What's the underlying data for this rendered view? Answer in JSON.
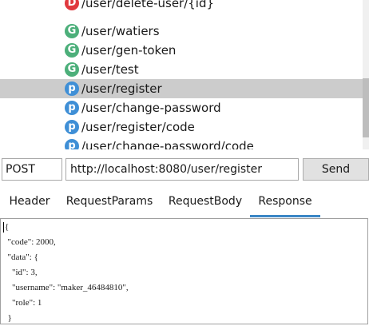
{
  "endpoints": [
    {
      "badge": "D",
      "method": "delete",
      "path": "/user/delete-user/{id}"
    },
    {
      "badge": "G",
      "method": "get",
      "path": "/user/watiers"
    },
    {
      "badge": "G",
      "method": "get",
      "path": "/user/gen-token"
    },
    {
      "badge": "G",
      "method": "get",
      "path": "/user/test"
    },
    {
      "badge": "p",
      "method": "post",
      "path": "/user/register",
      "selected": true
    },
    {
      "badge": "p",
      "method": "post",
      "path": "/user/change-password"
    },
    {
      "badge": "p",
      "method": "post",
      "path": "/user/register/code"
    },
    {
      "badge": "p",
      "method": "post",
      "path": "/user/change-password/code"
    }
  ],
  "request": {
    "method": "POST",
    "url": "http://localhost:8080/user/register",
    "send_label": "Send"
  },
  "tabs": [
    {
      "label": "Header"
    },
    {
      "label": "RequestParams"
    },
    {
      "label": "RequestBody"
    },
    {
      "label": "Response",
      "active": true
    }
  ],
  "response": {
    "lines": [
      "{",
      "  \"code\": 2000,",
      "  \"data\": {",
      "    \"id\": 3,",
      "    \"username\": \"maker_46484810\",",
      "    \"role\": 1",
      "  }"
    ]
  },
  "colors": {
    "get": "#4caf7a",
    "post": "#3f8fd6",
    "delete": "#e0393e",
    "selected_row": "#cccccc",
    "active_tab_underline": "#3b87c6"
  }
}
